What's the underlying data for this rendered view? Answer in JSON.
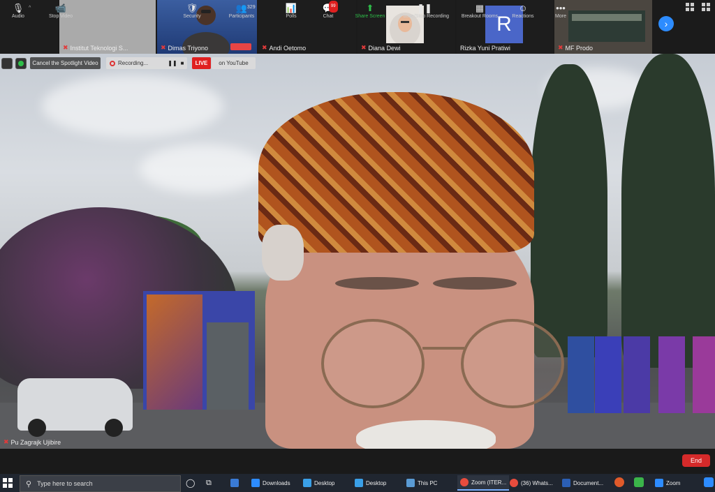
{
  "strip": {
    "participants": [
      {
        "name": "Institut Teknologi S...",
        "muted": true
      },
      {
        "name": "Dimas Triyono",
        "muted": true
      },
      {
        "name": "Andi Oetomo",
        "muted": true
      },
      {
        "name": "Diana Dewi",
        "muted": true
      },
      {
        "name": "Rizka Yuni Pratiwi",
        "muted": false
      },
      {
        "name": "MF Prodo",
        "muted": true
      }
    ],
    "avatar_initial": "R"
  },
  "overlay": {
    "spotlight_label": "Cancel the Spotlight Video",
    "recording_label": "Recording...",
    "pause_glyph": "❚❚",
    "stop_glyph": "■",
    "live_label": "LIVE",
    "youtube_label": "on YouTube"
  },
  "self_name": "Pu Zagrajk Ujibire",
  "toolbar": {
    "items": [
      {
        "label": "Audio",
        "icon": "🎙"
      },
      {
        "label": "Stop Video",
        "icon": "📹"
      },
      {
        "label": "Security",
        "icon": "🛡"
      },
      {
        "label": "Participants",
        "icon": "👥",
        "count": "329"
      },
      {
        "label": "Polls",
        "icon": "📊"
      },
      {
        "label": "Chat",
        "icon": "💬",
        "badge": "99"
      },
      {
        "label": "Share Screen",
        "icon": "⬆"
      },
      {
        "label": "Pause/Stop Recording",
        "icon": "❚❚"
      },
      {
        "label": "Breakout Rooms",
        "icon": "▦"
      },
      {
        "label": "Reactions",
        "icon": "☺"
      },
      {
        "label": "More",
        "icon": "•••"
      }
    ],
    "end_label": "End"
  },
  "taskbar": {
    "search_placeholder": "Type here to search",
    "items": [
      {
        "label": "Downloads"
      },
      {
        "label": "Desktop"
      },
      {
        "label": "Desktop"
      },
      {
        "label": "This PC"
      },
      {
        "label": "Zoom (ITER..."
      },
      {
        "label": "(36) Whats..."
      },
      {
        "label": "Document..."
      },
      {
        "label": "Zoom"
      }
    ]
  },
  "colors": {
    "accent_blue": "#2d8cff",
    "live_red": "#e02020",
    "share_green": "#2fbf4a",
    "end_red": "#d52a2a"
  }
}
